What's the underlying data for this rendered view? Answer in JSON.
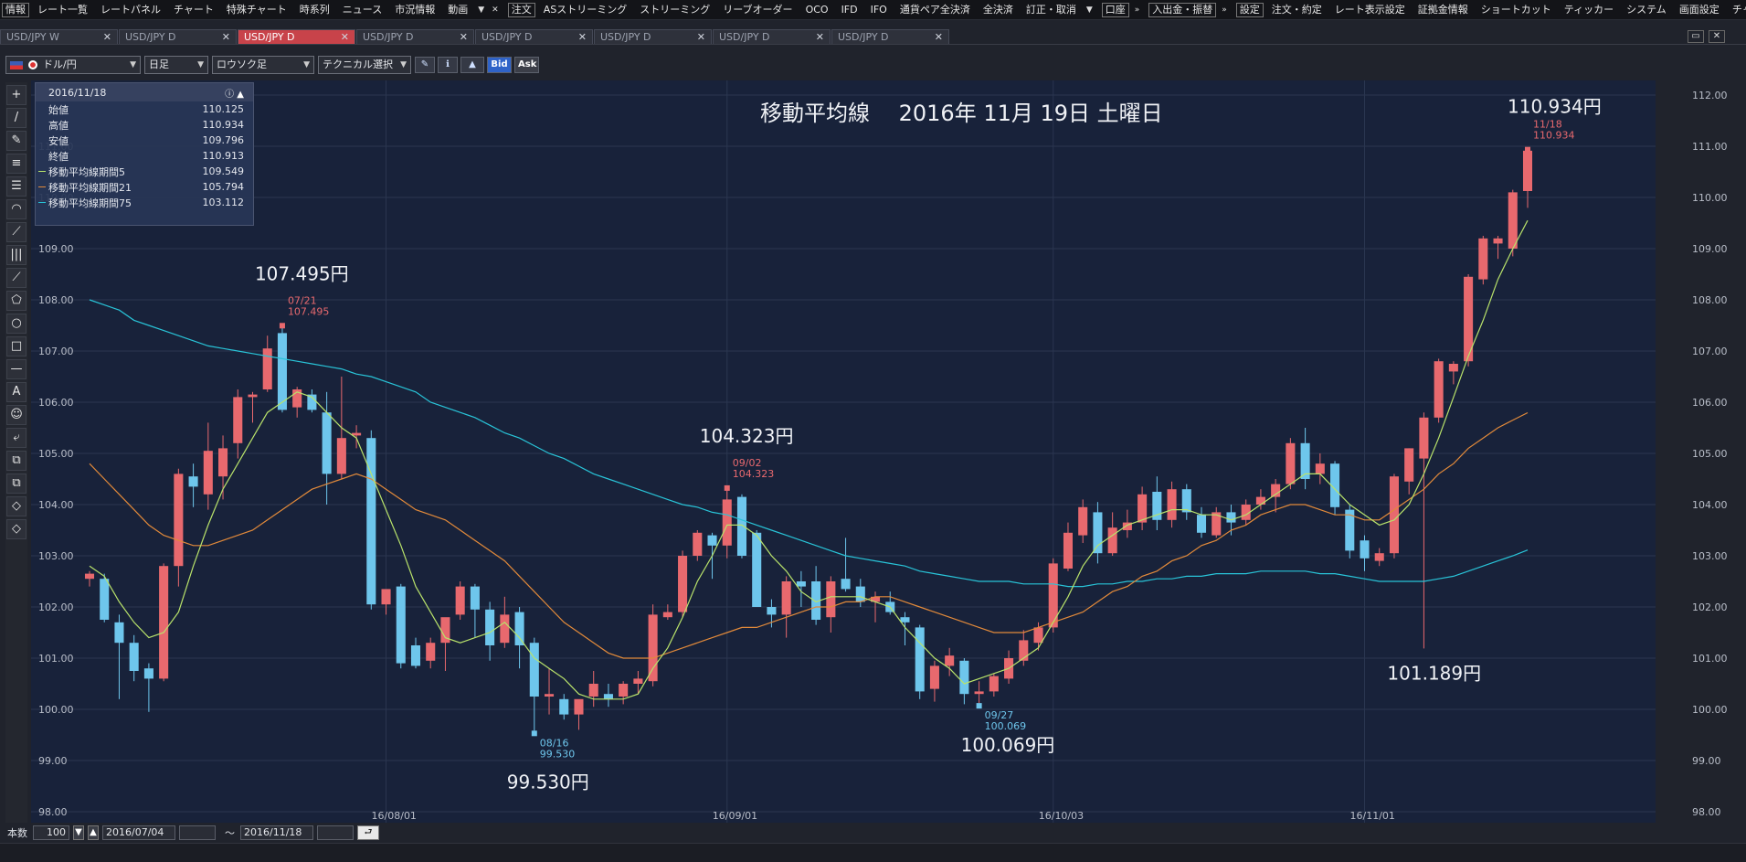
{
  "menubar": {
    "items": [
      "情報",
      "レート一覧",
      "レートパネル",
      "チャート",
      "特殊チャート",
      "時系列",
      "ニュース",
      "市況情報",
      "動画"
    ],
    "order_items": [
      "注文",
      "ASストリーミング",
      "ストリーミング",
      "リーブオーダー",
      "OCO",
      "IFD",
      "IFO",
      "通貨ペア全決済",
      "全決済",
      "訂正・取消"
    ],
    "account": "口座",
    "deposit": "入出金・振替",
    "settings_items": [
      "設定",
      "注文・約定",
      "レート表示設定",
      "証拠金情報",
      "ショートカット",
      "ティッカー",
      "システム",
      "画面設定",
      "チャート"
    ],
    "colors": {
      "sep_purple": "#8a3fd1",
      "sep_orange": "#e07a1f",
      "sep_green": "#33c24a",
      "sep_red": "#d8343b"
    }
  },
  "tabs": [
    {
      "label": "USD/JPY W",
      "active": false
    },
    {
      "label": "USD/JPY D",
      "active": false
    },
    {
      "label": "USD/JPY D",
      "active": true
    },
    {
      "label": "USD/JPY D",
      "active": false
    },
    {
      "label": "USD/JPY D",
      "active": false
    },
    {
      "label": "USD/JPY D",
      "active": false
    },
    {
      "label": "USD/JPY D",
      "active": false
    },
    {
      "label": "USD/JPY D",
      "active": false
    }
  ],
  "toolbar": {
    "pair": "ドル/円",
    "period": "日足",
    "chart_type": "ロウソク足",
    "technical": "テクニカル選択",
    "bid": "Bid",
    "ask": "Ask"
  },
  "left_tools": [
    "+",
    "/",
    "✎",
    "≡",
    "☰",
    "◠",
    "⟋",
    "|||",
    "⟋",
    "⬠",
    "○",
    "□",
    "—",
    "A",
    "☺",
    "⤶",
    "⧉",
    "⧉",
    "◇",
    "◇"
  ],
  "info": {
    "date": "2016/11/18",
    "rows": [
      {
        "label": "始値",
        "value": "110.125",
        "color": ""
      },
      {
        "label": "高値",
        "value": "110.934",
        "color": ""
      },
      {
        "label": "安値",
        "value": "109.796",
        "color": ""
      },
      {
        "label": "終値",
        "value": "110.913",
        "color": ""
      },
      {
        "label": "移動平均線期間5",
        "value": "109.549",
        "color": "#b9e36b"
      },
      {
        "label": "移動平均線期間21",
        "value": "105.794",
        "color": "#e28a3a"
      },
      {
        "label": "移動平均線期間75",
        "value": "103.112",
        "color": "#29c4d8"
      }
    ]
  },
  "chart_data": {
    "type": "candlestick",
    "title": "移動平均線　 2016年 11月 19日 土曜日",
    "ylim": [
      98.0,
      112.0
    ],
    "yticks": [
      "112.00",
      "111.00",
      "110.00",
      "109.00",
      "108.00",
      "107.00",
      "106.00",
      "105.00",
      "104.00",
      "103.00",
      "102.00",
      "101.00",
      "100.00",
      "99.00",
      "98.00"
    ],
    "xticks": [
      {
        "label": "16/08/01",
        "index": 20
      },
      {
        "label": "16/09/01",
        "index": 43
      },
      {
        "label": "16/10/03",
        "index": 65
      },
      {
        "label": "16/11/01",
        "index": 86
      }
    ],
    "colors": {
      "up": "#e8696e",
      "down": "#6ec6ec",
      "ma5": "#b9e36b",
      "ma21": "#e28a3a",
      "ma75": "#29c4d8"
    },
    "candles": [
      [
        102.55,
        102.7,
        102.4,
        102.65
      ],
      [
        102.55,
        102.65,
        101.7,
        101.75
      ],
      [
        101.7,
        101.85,
        100.2,
        101.3
      ],
      [
        101.3,
        101.45,
        100.55,
        100.75
      ],
      [
        100.8,
        100.9,
        99.95,
        100.6
      ],
      [
        100.6,
        102.85,
        100.55,
        102.8
      ],
      [
        102.8,
        104.7,
        102.4,
        104.6
      ],
      [
        104.55,
        104.8,
        103.95,
        104.35
      ],
      [
        104.2,
        105.6,
        103.9,
        105.05
      ],
      [
        104.55,
        105.35,
        104.1,
        105.1
      ],
      [
        105.2,
        106.25,
        104.9,
        106.1
      ],
      [
        106.1,
        106.2,
        105.6,
        106.15
      ],
      [
        106.25,
        107.3,
        106.2,
        107.05
      ],
      [
        107.35,
        107.495,
        105.8,
        105.85
      ],
      [
        105.9,
        106.3,
        105.7,
        106.25
      ],
      [
        106.15,
        106.25,
        105.8,
        105.85
      ],
      [
        105.8,
        106.2,
        104.0,
        104.6
      ],
      [
        104.6,
        106.5,
        104.5,
        105.3
      ],
      [
        105.35,
        105.55,
        105.1,
        105.4
      ],
      [
        105.3,
        105.45,
        101.95,
        102.05
      ],
      [
        102.05,
        102.3,
        101.85,
        102.35
      ],
      [
        102.4,
        102.45,
        100.8,
        100.9
      ],
      [
        101.25,
        101.4,
        100.8,
        100.85
      ],
      [
        100.95,
        101.4,
        100.8,
        101.3
      ],
      [
        101.3,
        101.55,
        100.75,
        101.8
      ],
      [
        101.85,
        102.5,
        101.75,
        102.4
      ],
      [
        102.4,
        102.45,
        101.4,
        101.95
      ],
      [
        101.95,
        102.1,
        100.95,
        101.25
      ],
      [
        101.3,
        102.2,
        101.2,
        101.85
      ],
      [
        101.9,
        102.0,
        100.8,
        101.25
      ],
      [
        101.3,
        101.4,
        99.53,
        100.25
      ],
      [
        100.25,
        100.8,
        99.9,
        100.3
      ],
      [
        100.2,
        100.3,
        99.8,
        99.9
      ],
      [
        99.9,
        100.15,
        99.6,
        100.2
      ],
      [
        100.25,
        100.75,
        100.05,
        100.5
      ],
      [
        100.3,
        100.5,
        100.05,
        100.2
      ],
      [
        100.25,
        100.55,
        100.1,
        100.5
      ],
      [
        100.5,
        100.75,
        100.3,
        100.6
      ],
      [
        100.55,
        102.05,
        100.45,
        101.85
      ],
      [
        101.8,
        102.05,
        101.75,
        101.9
      ],
      [
        101.9,
        103.1,
        101.8,
        103.0
      ],
      [
        103.0,
        103.5,
        102.9,
        103.45
      ],
      [
        103.4,
        103.45,
        102.55,
        103.2
      ],
      [
        103.2,
        104.323,
        102.95,
        104.1
      ],
      [
        104.15,
        104.2,
        102.95,
        103.0
      ],
      [
        103.45,
        103.5,
        102.0,
        102.0
      ],
      [
        102.0,
        102.15,
        101.6,
        101.85
      ],
      [
        101.85,
        102.6,
        101.4,
        102.5
      ],
      [
        102.5,
        102.7,
        102.0,
        102.4
      ],
      [
        102.5,
        102.8,
        101.65,
        101.75
      ],
      [
        101.8,
        102.6,
        101.5,
        102.5
      ],
      [
        102.55,
        103.35,
        102.3,
        102.35
      ],
      [
        102.4,
        102.55,
        102.0,
        102.1
      ],
      [
        102.1,
        102.3,
        101.7,
        102.2
      ],
      [
        102.1,
        102.3,
        101.85,
        101.9
      ],
      [
        101.8,
        101.9,
        101.25,
        101.7
      ],
      [
        101.6,
        101.65,
        100.2,
        100.35
      ],
      [
        100.4,
        100.95,
        100.15,
        100.85
      ],
      [
        100.85,
        101.2,
        100.65,
        101.05
      ],
      [
        100.95,
        101.0,
        100.1,
        100.3
      ],
      [
        100.3,
        100.55,
        100.069,
        100.35
      ],
      [
        100.35,
        100.7,
        100.25,
        100.65
      ],
      [
        100.6,
        101.15,
        100.5,
        101.0
      ],
      [
        100.95,
        101.55,
        100.85,
        101.35
      ],
      [
        101.3,
        101.7,
        101.15,
        101.6
      ],
      [
        101.6,
        102.95,
        101.5,
        102.85
      ],
      [
        102.75,
        103.65,
        102.7,
        103.45
      ],
      [
        103.4,
        104.1,
        103.25,
        103.95
      ],
      [
        103.85,
        104.05,
        102.85,
        103.05
      ],
      [
        103.05,
        103.85,
        103.0,
        103.55
      ],
      [
        103.5,
        103.9,
        103.35,
        103.65
      ],
      [
        103.65,
        104.35,
        103.5,
        104.2
      ],
      [
        104.25,
        104.55,
        103.5,
        103.7
      ],
      [
        103.7,
        104.45,
        103.55,
        104.3
      ],
      [
        104.3,
        104.4,
        103.7,
        103.85
      ],
      [
        103.8,
        103.95,
        103.35,
        103.45
      ],
      [
        103.4,
        103.95,
        103.35,
        103.85
      ],
      [
        103.85,
        104.0,
        103.4,
        103.65
      ],
      [
        103.7,
        104.1,
        103.6,
        104.0
      ],
      [
        104.0,
        104.3,
        103.9,
        104.15
      ],
      [
        104.15,
        104.5,
        103.85,
        104.4
      ],
      [
        104.4,
        105.3,
        104.3,
        105.2
      ],
      [
        105.2,
        105.5,
        104.3,
        104.5
      ],
      [
        104.6,
        105.0,
        104.4,
        104.8
      ],
      [
        104.8,
        104.85,
        103.8,
        103.95
      ],
      [
        103.9,
        104.0,
        102.95,
        103.1
      ],
      [
        103.3,
        103.4,
        102.7,
        102.95
      ],
      [
        102.9,
        103.15,
        102.8,
        103.05
      ],
      [
        103.05,
        104.6,
        102.95,
        104.55
      ],
      [
        104.45,
        105.1,
        104.2,
        105.1
      ],
      [
        104.9,
        105.8,
        101.189,
        105.7
      ],
      [
        105.7,
        106.85,
        105.6,
        106.8
      ],
      [
        106.6,
        106.8,
        106.35,
        106.75
      ],
      [
        106.8,
        108.5,
        106.7,
        108.45
      ],
      [
        108.4,
        109.25,
        108.3,
        109.2
      ],
      [
        109.1,
        109.25,
        108.8,
        109.2
      ],
      [
        109.0,
        110.15,
        108.85,
        110.1
      ],
      [
        110.125,
        110.934,
        109.796,
        110.913
      ]
    ],
    "ma5": [
      102.8,
      102.6,
      102.1,
      101.7,
      101.4,
      101.5,
      101.9,
      102.8,
      103.6,
      104.3,
      104.8,
      105.3,
      105.8,
      106.0,
      106.2,
      106.1,
      105.8,
      105.5,
      105.3,
      104.6,
      103.9,
      103.2,
      102.4,
      101.9,
      101.4,
      101.3,
      101.4,
      101.5,
      101.7,
      101.4,
      101.0,
      100.8,
      100.6,
      100.3,
      100.2,
      100.2,
      100.2,
      100.3,
      100.8,
      101.2,
      101.8,
      102.5,
      103.0,
      103.6,
      103.6,
      103.4,
      103.0,
      102.7,
      102.3,
      102.1,
      102.2,
      102.2,
      102.2,
      102.1,
      102.0,
      101.6,
      101.3,
      101.0,
      100.8,
      100.5,
      100.6,
      100.7,
      100.8,
      101.0,
      101.2,
      101.7,
      102.2,
      102.8,
      103.2,
      103.4,
      103.6,
      103.7,
      103.8,
      103.9,
      103.9,
      103.8,
      103.8,
      103.7,
      103.8,
      104.0,
      104.2,
      104.4,
      104.6,
      104.6,
      104.3,
      104.0,
      103.8,
      103.6,
      103.7,
      104.0,
      104.6,
      105.3,
      106.1,
      106.9,
      107.6,
      108.4,
      109.0,
      109.55
    ],
    "ma21": [
      104.8,
      104.5,
      104.2,
      103.9,
      103.6,
      103.4,
      103.3,
      103.2,
      103.2,
      103.3,
      103.4,
      103.5,
      103.7,
      103.9,
      104.1,
      104.3,
      104.4,
      104.5,
      104.6,
      104.5,
      104.3,
      104.1,
      103.9,
      103.8,
      103.7,
      103.5,
      103.3,
      103.1,
      102.9,
      102.6,
      102.3,
      102.0,
      101.7,
      101.5,
      101.3,
      101.1,
      101.0,
      101.0,
      101.0,
      101.1,
      101.2,
      101.3,
      101.4,
      101.5,
      101.6,
      101.6,
      101.7,
      101.8,
      101.9,
      102.0,
      102.0,
      102.1,
      102.1,
      102.2,
      102.2,
      102.1,
      102.0,
      101.9,
      101.8,
      101.7,
      101.6,
      101.5,
      101.5,
      101.5,
      101.6,
      101.7,
      101.8,
      101.9,
      102.1,
      102.3,
      102.4,
      102.6,
      102.7,
      102.9,
      103.0,
      103.2,
      103.3,
      103.5,
      103.6,
      103.8,
      103.9,
      104.0,
      104.0,
      103.9,
      103.8,
      103.8,
      103.7,
      103.7,
      103.9,
      104.1,
      104.3,
      104.6,
      104.8,
      105.1,
      105.3,
      105.5,
      105.65,
      105.794
    ],
    "ma75": [
      108.0,
      107.9,
      107.8,
      107.6,
      107.5,
      107.4,
      107.3,
      107.2,
      107.1,
      107.05,
      107.0,
      106.95,
      106.9,
      106.85,
      106.8,
      106.75,
      106.7,
      106.65,
      106.55,
      106.5,
      106.4,
      106.3,
      106.2,
      106.0,
      105.9,
      105.8,
      105.7,
      105.55,
      105.4,
      105.3,
      105.15,
      105.0,
      104.9,
      104.75,
      104.6,
      104.5,
      104.4,
      104.3,
      104.2,
      104.1,
      104.0,
      103.95,
      103.85,
      103.8,
      103.7,
      103.6,
      103.5,
      103.4,
      103.3,
      103.2,
      103.1,
      103.0,
      102.95,
      102.9,
      102.85,
      102.8,
      102.7,
      102.65,
      102.6,
      102.55,
      102.5,
      102.5,
      102.5,
      102.45,
      102.45,
      102.45,
      102.4,
      102.4,
      102.45,
      102.45,
      102.5,
      102.5,
      102.55,
      102.55,
      102.6,
      102.6,
      102.65,
      102.65,
      102.65,
      102.7,
      102.7,
      102.7,
      102.7,
      102.65,
      102.65,
      102.6,
      102.55,
      102.5,
      102.5,
      102.5,
      102.5,
      102.55,
      102.6,
      102.7,
      102.8,
      102.9,
      103.0,
      103.112
    ],
    "annotations": [
      {
        "index": 13,
        "price": 107.495,
        "big": "107.495円",
        "date": "07/21",
        "value": "107.495",
        "kind": "high"
      },
      {
        "index": 30,
        "price": 99.53,
        "big": "99.530円",
        "date": "08/16",
        "value": "99.530",
        "kind": "low"
      },
      {
        "index": 43,
        "price": 104.323,
        "big": "104.323円",
        "date": "09/02",
        "value": "104.323",
        "kind": "high"
      },
      {
        "index": 60,
        "price": 100.069,
        "big": "100.069円",
        "date": "09/27",
        "value": "100.069",
        "kind": "low"
      },
      {
        "index": 90,
        "price": 101.189,
        "big": "101.189円",
        "date": "",
        "value": "",
        "kind": "low-plain"
      },
      {
        "index": 97,
        "price": 110.934,
        "big": "110.934円",
        "date": "11/18",
        "value": "110.934",
        "kind": "high"
      }
    ]
  },
  "status": {
    "count_label": "本数",
    "count": "100",
    "from": "2016/07/04",
    "tilde": "〜",
    "to": "2016/11/18"
  }
}
